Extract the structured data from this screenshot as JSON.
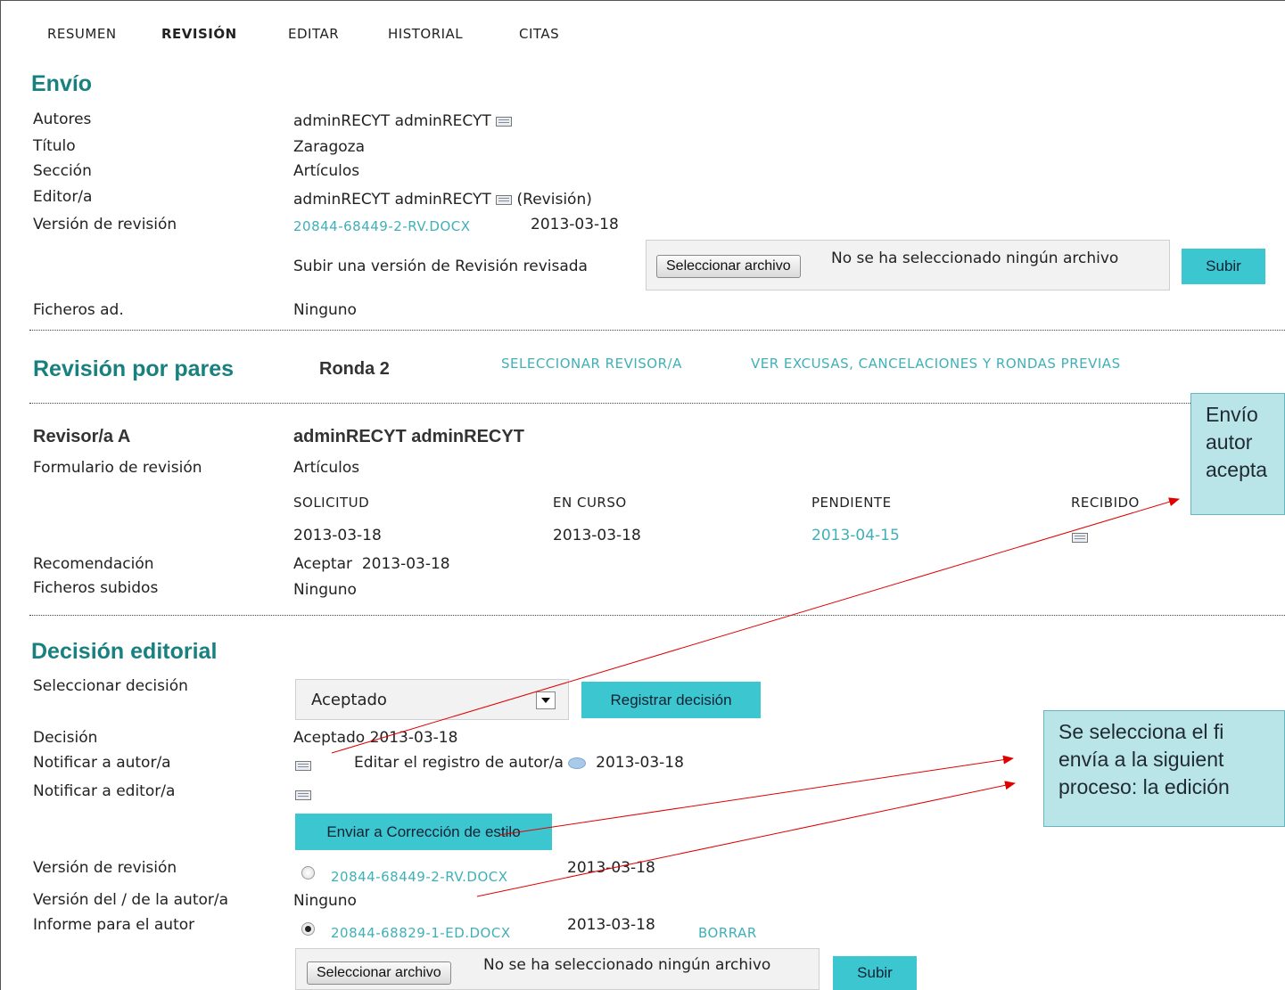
{
  "tabs": [
    {
      "label": "RESUMEN",
      "active": false
    },
    {
      "label": "REVISIÓN",
      "active": true
    },
    {
      "label": "EDITAR",
      "active": false
    },
    {
      "label": "HISTORIAL",
      "active": false
    },
    {
      "label": "CITAS",
      "active": false
    }
  ],
  "envio": {
    "title": "Envío",
    "autores_label": "Autores",
    "autores_value": "adminRECYT adminRECYT",
    "titulo_label": "Título",
    "titulo_value": "Zaragoza",
    "seccion_label": "Sección",
    "seccion_value": "Artículos",
    "editor_label": "Editor/a",
    "editor_value": "adminRECYT adminRECYT",
    "editor_suffix": "(Revisión)",
    "version_label": "Versión de revisión",
    "version_file": "20844-68449-2-RV.DOCX",
    "version_date": "2013-03-18",
    "upload_label": "Subir una versión de Revisión revisada",
    "choose_file": "Seleccionar archivo",
    "no_file": "No se ha seleccionado ningún archivo",
    "upload_button": "Subir",
    "ficheros_label": "Ficheros ad.",
    "ficheros_value": "Ninguno"
  },
  "peer": {
    "title": "Revisión por pares",
    "round": "Ronda 2",
    "select_reviewer": "SELECCIONAR REVISOR/A",
    "view_excuses": "VER EXCUSAS, CANCELACIONES Y RONDAS PREVIAS",
    "reviewer_label": "Revisor/a A",
    "reviewer_name": "adminRECYT adminRECYT",
    "form_label": "Formulario de revisión",
    "form_value": "Artículos",
    "col_solicitud": "SOLICITUD",
    "col_encurso": "EN CURSO",
    "col_pendiente": "PENDIENTE",
    "col_recibido": "RECIBIDO",
    "date_solicitud": "2013-03-18",
    "date_encurso": "2013-03-18",
    "date_pendiente": "2013-04-15",
    "recomendacion_label": "Recomendación",
    "recomendacion_value": "Aceptar",
    "recomendacion_date": "2013-03-18",
    "subidos_label": "Ficheros subidos",
    "subidos_value": "Ninguno"
  },
  "decision": {
    "title": "Decisión editorial",
    "select_label": "Seleccionar decisión",
    "select_value": "Aceptado",
    "register_button": "Registrar decisión",
    "decision_label": "Decisión",
    "decision_value": "Aceptado",
    "decision_date": "2013-03-18",
    "notify_author_label": "Notificar a autor/a",
    "edit_author_log": "Editar el registro de autor/a",
    "notify_author_date": "2013-03-18",
    "notify_editor_label": "Notificar a editor/a",
    "send_copyedit_button": "Enviar a Corrección de estilo",
    "review_version_label": "Versión de revisión",
    "review_version_file": "20844-68449-2-RV.DOCX",
    "review_version_date": "2013-03-18",
    "author_version_label": "Versión del / de la autor/a",
    "author_version_value": "Ninguno",
    "report_label": "Informe para el autor",
    "report_file": "20844-68829-1-ED.DOCX",
    "report_date": "2013-03-18",
    "delete_link": "BORRAR",
    "choose_file": "Seleccionar archivo",
    "no_file": "No se ha seleccionado ningún archivo",
    "upload_button": "Subir"
  },
  "callouts": {
    "top_line1": "Envío",
    "top_line2": "autor",
    "top_line3": "acepta",
    "bottom_line1": "Se selecciona el fi",
    "bottom_line2": "envía a la siguient",
    "bottom_line3": "proceso: la edición"
  },
  "colors": {
    "heading": "#18807f",
    "link": "#40b0b8",
    "button": "#3cc6cf",
    "callout_bg": "#b9e4e8",
    "arrow": "#e00000"
  }
}
